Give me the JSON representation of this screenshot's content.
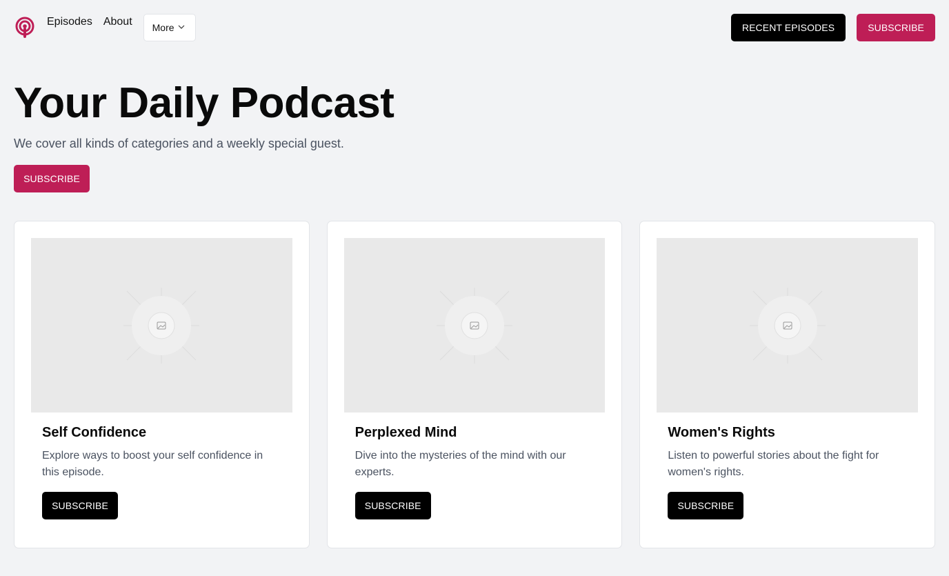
{
  "nav": {
    "links": [
      "Episodes",
      "About"
    ],
    "more_label": "More",
    "recent_label": "RECENT EPISODES",
    "subscribe_label": "SUBSCRIBE"
  },
  "hero": {
    "title": "Your Daily Podcast",
    "subtitle": "We cover all kinds of categories and a weekly special guest.",
    "subscribe_label": "SUBSCRIBE"
  },
  "cards": [
    {
      "title": "Self Confidence",
      "description": "Explore ways to boost your self confidence in this episode.",
      "button_label": "SUBSCRIBE"
    },
    {
      "title": "Perplexed Mind",
      "description": "Dive into the mysteries of the mind with our experts.",
      "button_label": "SUBSCRIBE"
    },
    {
      "title": "Women's Rights",
      "description": "Listen to powerful stories about the fight for women's rights.",
      "button_label": "SUBSCRIBE"
    }
  ],
  "colors": {
    "accent": "#be1e56",
    "background": "#f2f3f5",
    "button_dark": "#000000"
  },
  "icons": {
    "logo": "podcast-icon",
    "more": "chevron-down-icon",
    "card_image": "image-placeholder-icon"
  }
}
